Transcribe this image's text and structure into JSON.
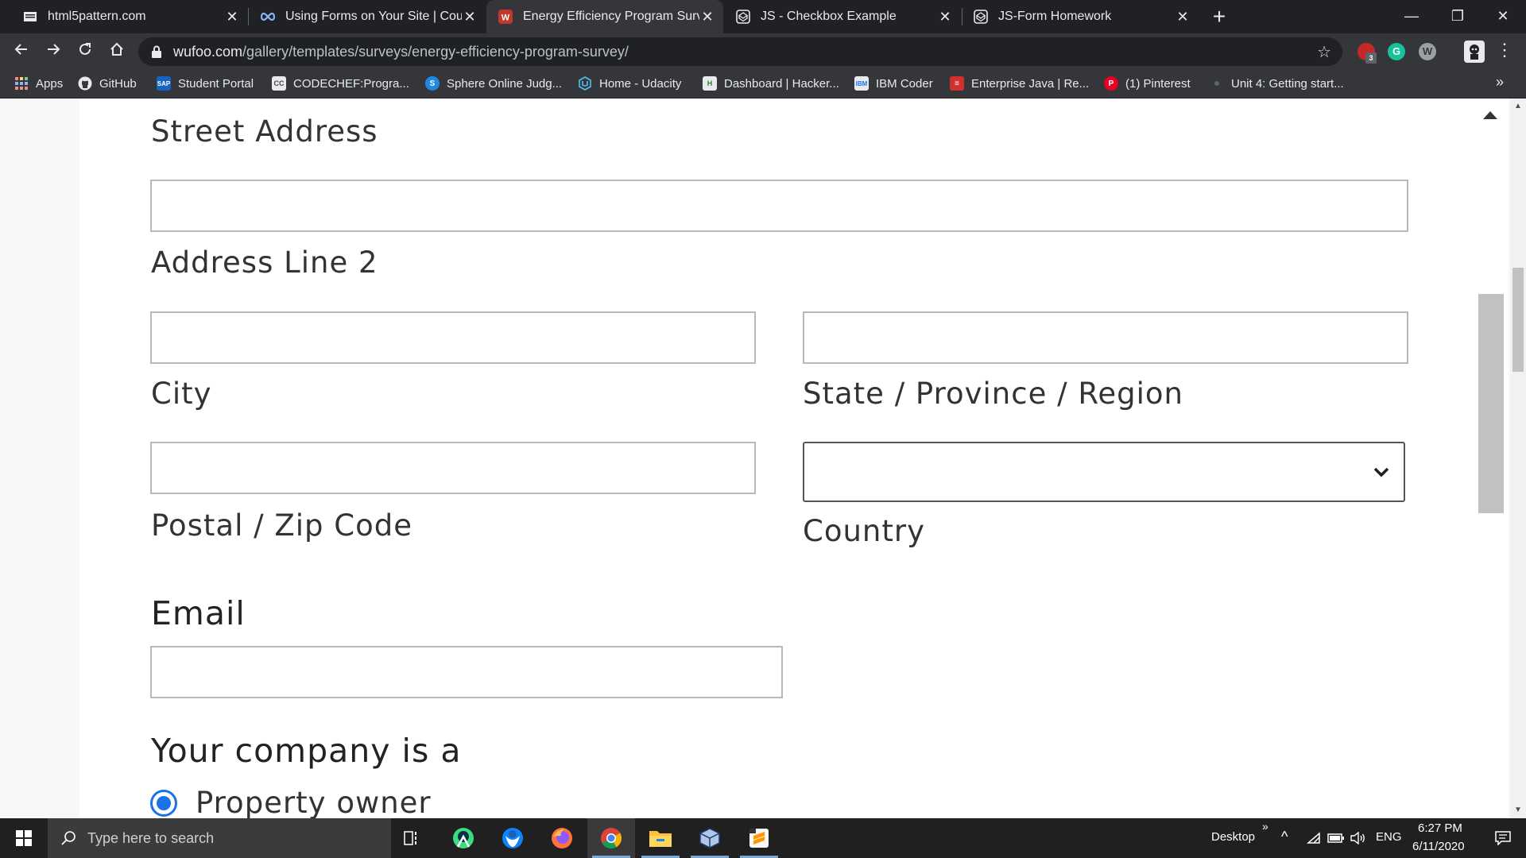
{
  "tabs": [
    {
      "title": "html5pattern.com",
      "favicon": "page-icon"
    },
    {
      "title": "Using Forms on Your Site | Course",
      "favicon": "infinity-icon"
    },
    {
      "title": "Energy Efficiency Program Survey",
      "favicon": "wufoo-icon",
      "active": true
    },
    {
      "title": "JS - Checkbox Example",
      "favicon": "codepen-icon"
    },
    {
      "title": "JS-Form Homework",
      "favicon": "codepen-icon"
    }
  ],
  "tab_close_glyph": "✕",
  "new_tab_glyph": "+",
  "window_controls": {
    "minimize": "—",
    "restore": "❐",
    "close": "✕"
  },
  "toolbar": {
    "url_host": "wufoo.com",
    "url_path": "/gallery/templates/surveys/energy-efficiency-program-survey/",
    "star_glyph": "☆",
    "extension_badge": "3",
    "grammarly_letter": "G",
    "extension_w_letter": "W",
    "menu_glyph": "⋮"
  },
  "bookmarks": [
    {
      "label": "Apps",
      "icon": "apps-grid-icon"
    },
    {
      "label": "GitHub",
      "icon": "github-icon"
    },
    {
      "label": "Student Portal",
      "icon": "sap-icon"
    },
    {
      "label": "CODECHEF:Progra...",
      "icon": "codechef-icon"
    },
    {
      "label": "Sphere Online Judg...",
      "icon": "spoj-icon"
    },
    {
      "label": "Home - Udacity",
      "icon": "udacity-icon"
    },
    {
      "label": "Dashboard | Hacker...",
      "icon": "hackerrank-icon"
    },
    {
      "label": "IBM Coder",
      "icon": "ibm-icon"
    },
    {
      "label": "Enterprise Java | Re...",
      "icon": "java-icon"
    },
    {
      "label": "(1) Pinterest",
      "icon": "pinterest-icon"
    },
    {
      "label": "Unit 4: Getting start...",
      "icon": "unit-icon"
    }
  ],
  "bookmarks_more": "»",
  "form": {
    "street_address_label": "Street Address",
    "address_line2_label": "Address Line 2",
    "city_label": "City",
    "state_label": "State / Province / Region",
    "postal_label": "Postal / Zip Code",
    "country_label": "Country",
    "email_heading": "Email",
    "company_heading": "Your company is a",
    "company_option_1": "Property owner",
    "fields": {
      "street": "",
      "line2": "",
      "city": "",
      "state": "",
      "postal": "",
      "country": "",
      "email": ""
    }
  },
  "colors": {
    "accent": "#1a73e8",
    "chrome_dark": "#202124",
    "chrome_toolbar": "#35363a",
    "taskbar": "#202020"
  },
  "taskbar": {
    "search_placeholder": "Type here to search",
    "desktop_label": "Desktop",
    "desktop_chevron": "»",
    "tray_up_glyph": "^",
    "language": "ENG",
    "time": "6:27 PM",
    "date": "6/11/2020",
    "apps": [
      "task-view-icon",
      "android-studio-icon",
      "thunderbird-icon",
      "firefox-icon",
      "chrome-icon",
      "file-explorer-icon",
      "virtualbox-icon",
      "sublime-icon"
    ]
  }
}
